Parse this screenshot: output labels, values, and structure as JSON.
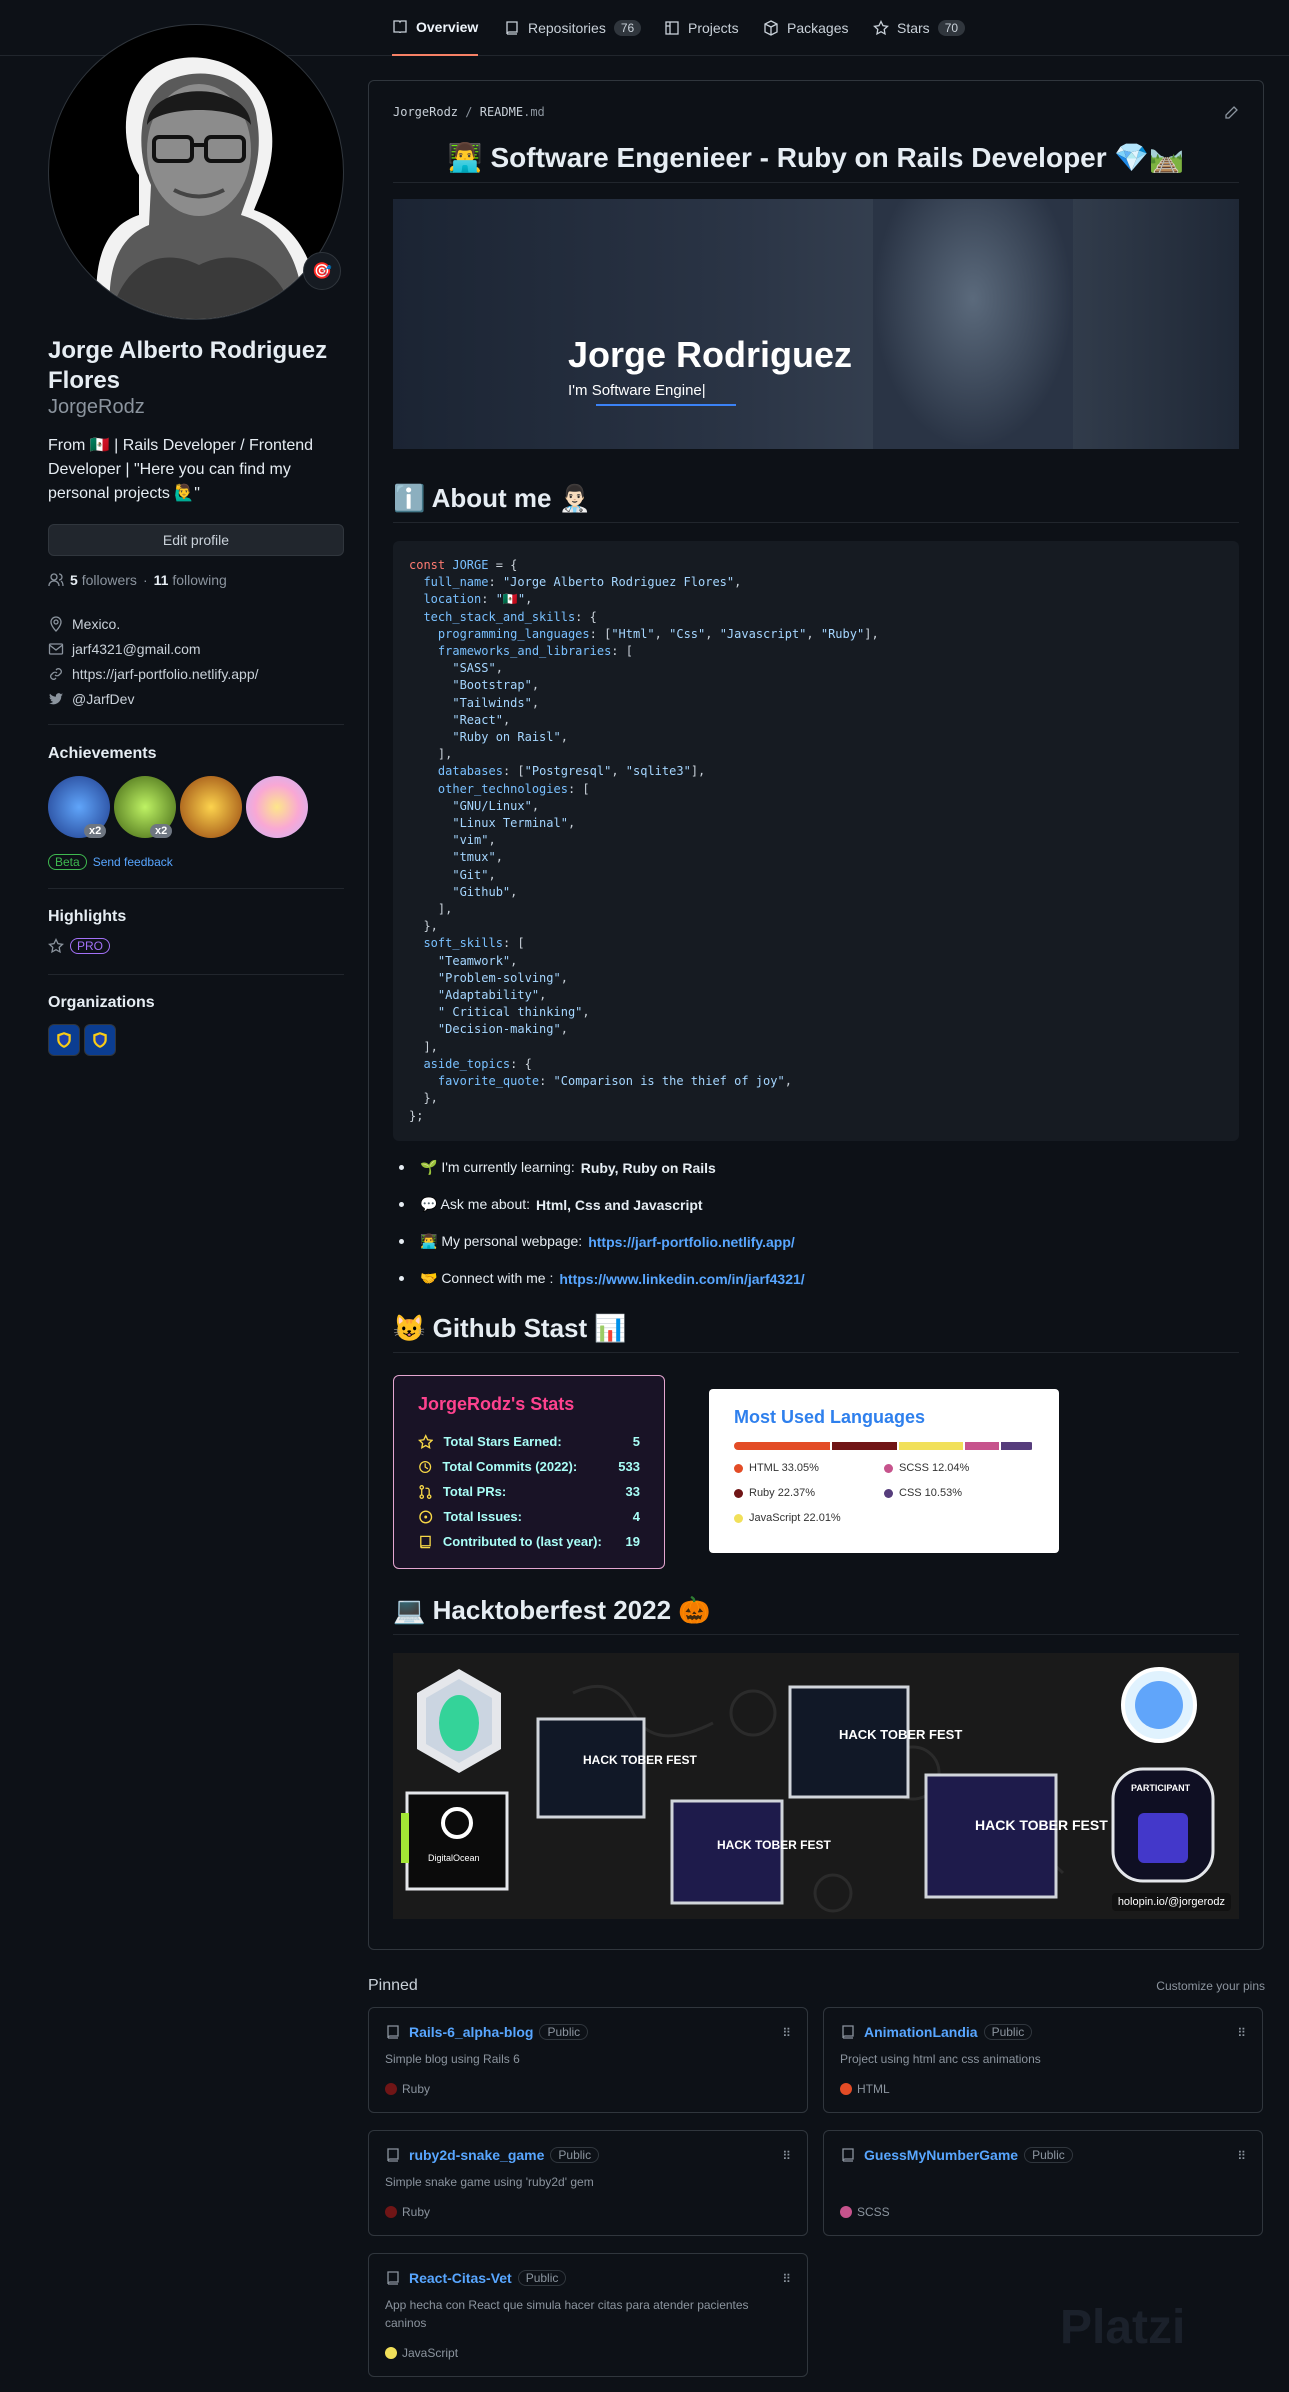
{
  "tabs": [
    {
      "label": "Overview",
      "count": null,
      "icon": "book-icon"
    },
    {
      "label": "Repositories",
      "count": "76",
      "icon": "repo-icon"
    },
    {
      "label": "Projects",
      "count": null,
      "icon": "project-icon"
    },
    {
      "label": "Packages",
      "count": null,
      "icon": "package-icon"
    },
    {
      "label": "Stars",
      "count": "70",
      "icon": "star-icon"
    }
  ],
  "profile": {
    "status_emoji": "🎯",
    "full_name": "Jorge Alberto Rodriguez Flores",
    "login": "JorgeRodz",
    "bio": "From 🇲🇽 | Rails Developer / Frontend Developer | \"Here you can find my personal projects 🙋‍♂️\"",
    "edit_label": "Edit profile",
    "followers": "5",
    "followers_label": "followers",
    "following": "11",
    "following_label": "following",
    "location": "Mexico.",
    "email": "jarf4321@gmail.com",
    "website": "https://jarf-portfolio.netlify.app/",
    "twitter": "@JarfDev"
  },
  "achievements": {
    "title": "Achievements",
    "badges": [
      {
        "name": "Pull Shark",
        "count": "x2",
        "color": "#3b82f6"
      },
      {
        "name": "Pair Extraordinaire",
        "count": "x2",
        "color": "#84cc16"
      },
      {
        "name": "Quickdraw",
        "count": "",
        "color": "#f59e0b"
      },
      {
        "name": "YOLO",
        "count": "",
        "color": "#f9a8d4"
      }
    ],
    "beta": "Beta",
    "feedback": "Send feedback"
  },
  "highlights": {
    "title": "Highlights",
    "pro": "PRO"
  },
  "organizations": {
    "title": "Organizations"
  },
  "readme": {
    "owner": "JorgeRodz",
    "sep": "/",
    "file": "README",
    "ext": ".md",
    "title": "👨‍💻 Software Engenieer - Ruby on Rails Developer 💎🛤️",
    "banner_name": "Jorge Rodriguez",
    "banner_sub": "I'm Software Engine|",
    "about": "ℹ️ About me 👨🏻‍⚕️",
    "bullets": [
      {
        "prefix": "🌱 I'm currently learning: ",
        "strong": "Ruby, Ruby on Rails",
        "link": false
      },
      {
        "prefix": "💬 Ask me about: ",
        "strong": "Html, Css and Javascript",
        "link": false
      },
      {
        "prefix": "👨‍💻 My personal webpage: ",
        "strong": "https://jarf-portfolio.netlify.app/",
        "link": true
      },
      {
        "prefix": "🤝 Connect with me : ",
        "strong": "https://www.linkedin.com/in/jarf4321/",
        "link": true
      }
    ],
    "stats_heading": "😺 Github Stast 📊",
    "hack_heading": "💻 Hacktoberfest 2022 🎃",
    "holopin": "holopin.io/@jorgerodz"
  },
  "stats": {
    "title": "JorgeRodz's Stats",
    "rows": [
      {
        "label": "Total Stars Earned:",
        "value": "5",
        "icon": "star-icon"
      },
      {
        "label": "Total Commits (2022):",
        "value": "533",
        "icon": "history-icon"
      },
      {
        "label": "Total PRs:",
        "value": "33",
        "icon": "pr-icon"
      },
      {
        "label": "Total Issues:",
        "value": "4",
        "icon": "issue-icon"
      },
      {
        "label": "Contributed to (last year):",
        "value": "19",
        "icon": "repo-icon"
      }
    ]
  },
  "languages": {
    "title": "Most Used Languages",
    "items": [
      {
        "name": "HTML",
        "pct": 33.05,
        "label": "HTML 33.05%",
        "color": "#e34c26"
      },
      {
        "name": "Ruby",
        "pct": 22.37,
        "label": "Ruby 22.37%",
        "color": "#701516"
      },
      {
        "name": "JavaScript",
        "pct": 22.01,
        "label": "JavaScript 22.01%",
        "color": "#f1e05a"
      },
      {
        "name": "SCSS",
        "pct": 12.04,
        "label": "SCSS 12.04%",
        "color": "#c6538c"
      },
      {
        "name": "CSS",
        "pct": 10.53,
        "label": "CSS 10.53%",
        "color": "#563d7c"
      }
    ]
  },
  "pinned": {
    "title": "Pinned",
    "customize": "Customize your pins",
    "public": "Public",
    "repos": [
      {
        "name": "Rails-6_alpha-blog",
        "desc": "Simple blog using Rails 6",
        "lang": "Ruby",
        "color": "#701516"
      },
      {
        "name": "AnimationLandia",
        "desc": "Project using html anc css animations",
        "lang": "HTML",
        "color": "#e34c26"
      },
      {
        "name": "ruby2d-snake_game",
        "desc": "Simple snake game using 'ruby2d' gem",
        "lang": "Ruby",
        "color": "#701516"
      },
      {
        "name": "GuessMyNumberGame",
        "desc": "",
        "lang": "SCSS",
        "color": "#c6538c"
      },
      {
        "name": "React-Citas-Vet",
        "desc": "App hecha con React que simula hacer citas para atender pacientes caninos",
        "lang": "JavaScript",
        "color": "#f1e05a"
      }
    ]
  },
  "watermark": "Platzi"
}
